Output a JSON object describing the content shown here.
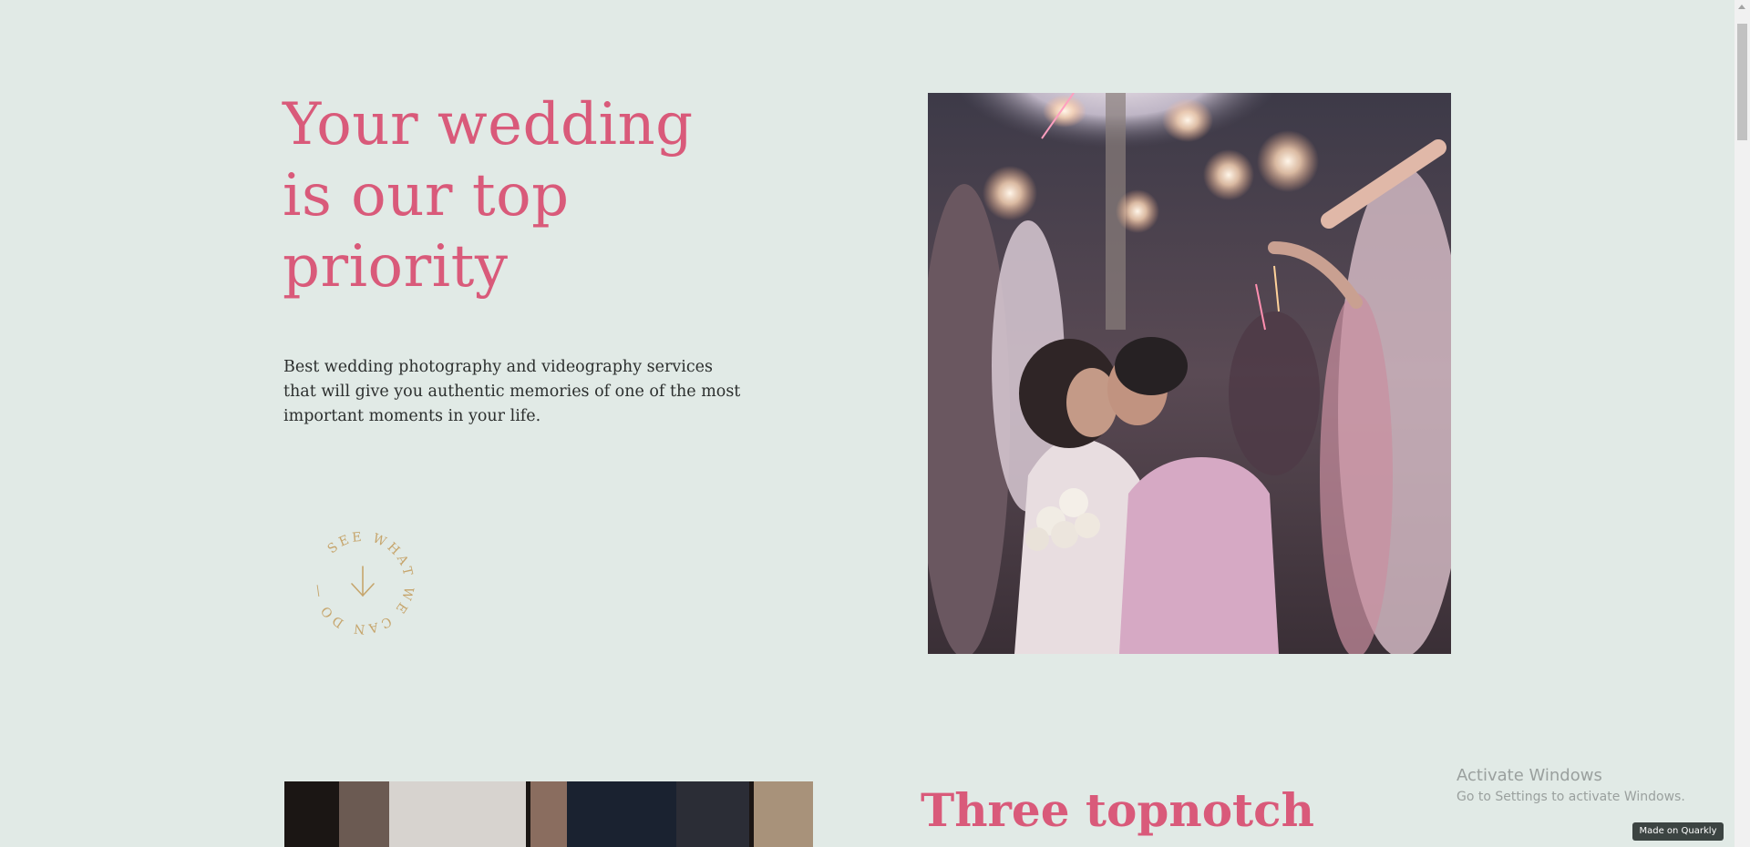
{
  "hero": {
    "title_lines": [
      "Your wedding",
      "is our top",
      "priority"
    ],
    "description_lines": [
      "Best wedding photography and videography services",
      "that will give you authentic memories of one of the most",
      "important moments in your life."
    ],
    "circle_cta_text": "SEE WHAT WE CAN DO —",
    "circle_cta_icon": "arrow-down-icon",
    "photo_icon": "wedding-couple-sparklers-photo"
  },
  "section2": {
    "title": "Three topnotch",
    "photo_icon": "wedding-couple-holding-hands-photo"
  },
  "system": {
    "activate_title": "Activate Windows",
    "activate_subtitle": "Go to Settings to activate Windows."
  },
  "badge": {
    "label": "Made on Quarkly"
  },
  "colors": {
    "background": "#e1eae6",
    "accent_pink": "#d95a7a",
    "gold": "#c6a56c",
    "text_dark": "#2c2f2e"
  }
}
